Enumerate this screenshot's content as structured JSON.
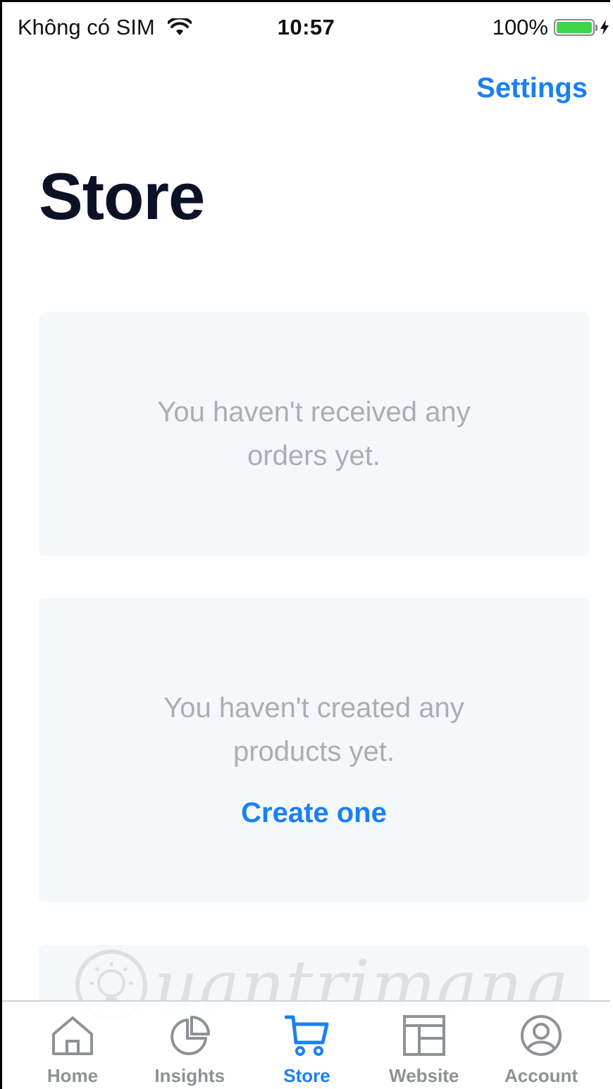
{
  "status_bar": {
    "carrier": "Không có SIM",
    "time": "10:57",
    "battery": "100%",
    "battery_level": 100
  },
  "nav": {
    "settings_label": "Settings"
  },
  "page": {
    "title": "Store"
  },
  "orders_card": {
    "message": "You haven't received any orders yet."
  },
  "products_card": {
    "message": "You haven't created any products yet.",
    "action_label": "Create one"
  },
  "watermark": {
    "text": "uantrimang"
  },
  "tab_bar": {
    "tabs": [
      {
        "label": "Home",
        "icon": "home-icon",
        "active": false
      },
      {
        "label": "Insights",
        "icon": "pie-chart-icon",
        "active": false
      },
      {
        "label": "Store",
        "icon": "cart-icon",
        "active": true
      },
      {
        "label": "Website",
        "icon": "layout-icon",
        "active": false
      },
      {
        "label": "Account",
        "icon": "user-icon",
        "active": false
      }
    ]
  },
  "colors": {
    "accent": "#1a7ff5",
    "title": "#0b1226",
    "card_background": "#f5f8fb",
    "muted_text": "#a9aeb6",
    "tab_inactive": "#8e9196",
    "battery": "#3fd54a"
  }
}
